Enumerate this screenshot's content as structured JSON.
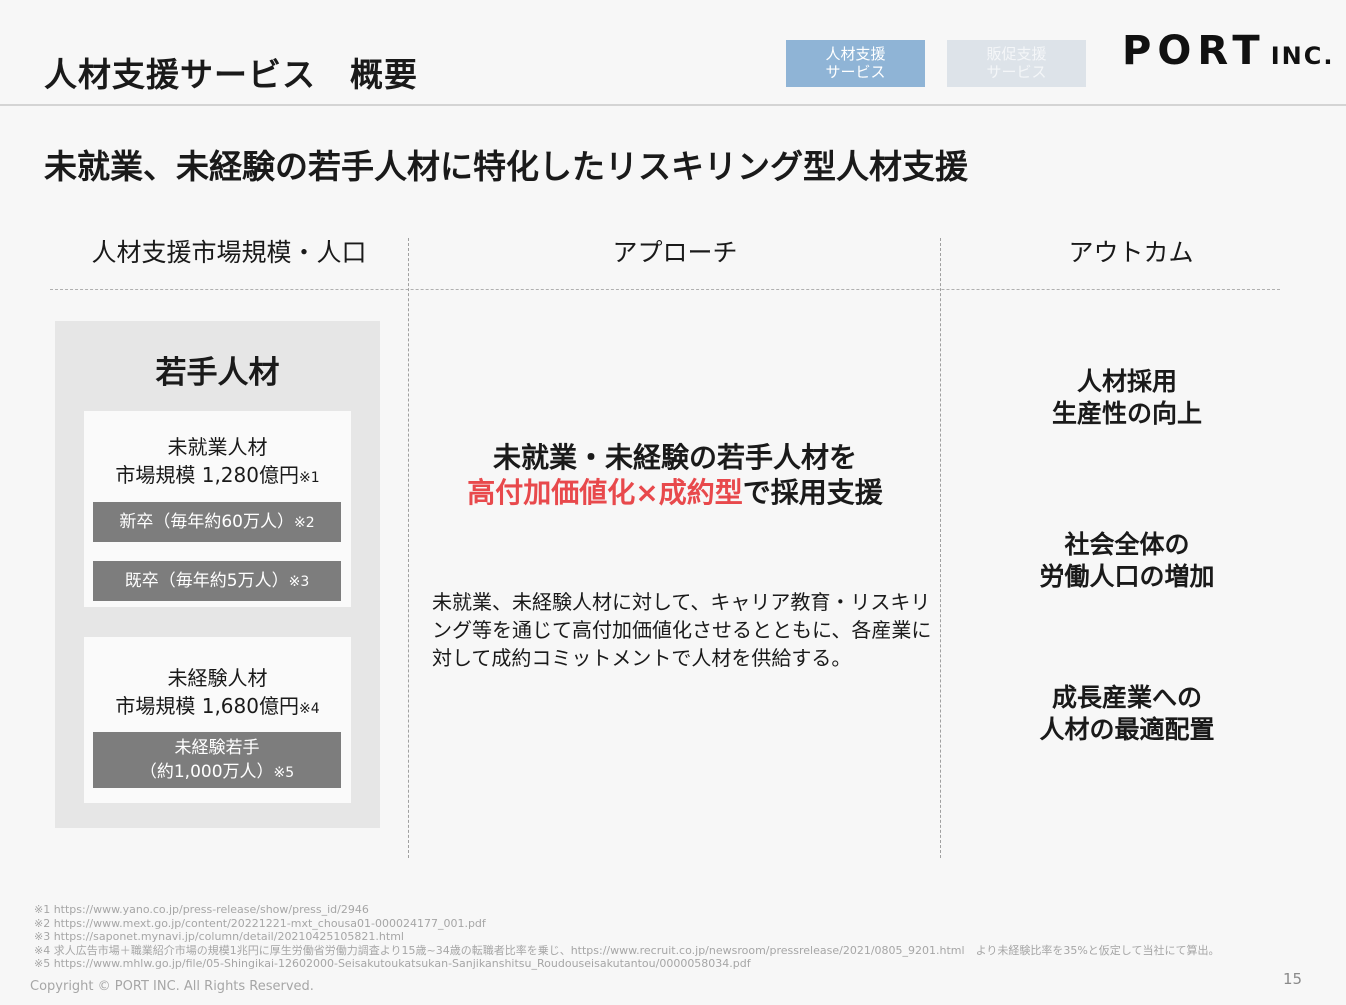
{
  "header": {
    "title": "人材支援サービス　概要",
    "tag_active_line1": "人材支援",
    "tag_active_line2": "サービス",
    "tag_inactive_line1": "販促支援",
    "tag_inactive_line2": "サービス",
    "logo_text": "PORT",
    "logo_suffix": "INC."
  },
  "main_heading": "未就業、未経験の若手人材に特化したリスキリング型人材支援",
  "columns": {
    "market": "人材支援市場規模・人口",
    "approach": "アプローチ",
    "outcome": "アウトカム"
  },
  "market": {
    "title": "若手人材",
    "card1": {
      "label": "未就業人材",
      "size": "市場規模 1,280億円",
      "note": "※1",
      "bar1": "新卒（毎年約60万人）",
      "bar1_note": "※2",
      "bar2": "既卒（毎年約5万人）",
      "bar2_note": "※3"
    },
    "card2": {
      "label": "未経験人材",
      "size": "市場規模 1,680億円",
      "note": "※4",
      "bar_line1": "未経験若手",
      "bar_line2": "（約1,000万人）",
      "bar_note": "※5"
    }
  },
  "approach": {
    "line1": "未就業・未経験の若手人材を",
    "line2_red": "高付加価値化×成約型",
    "line2_rest": "で採用支援",
    "body": "未就業、未経験人材に対して、キャリア教育・リスキリング等を通じて高付加価値化させるとともに、各産業に対して成約コミットメントで人材を供給する。"
  },
  "outcomes": [
    {
      "line1": "人材採用",
      "line2": "生産性の向上"
    },
    {
      "line1": "社会全体の",
      "line2": "労働人口の増加"
    },
    {
      "line1": "成長産業への",
      "line2": "人材の最適配置"
    }
  ],
  "footnotes": [
    "※1 https://www.yano.co.jp/press-release/show/press_id/2946",
    "※2 https://www.mext.go.jp/content/20221221-mxt_chousa01-000024177_001.pdf",
    "※3 https://saponet.mynavi.jp/column/detail/20210425105821.html",
    "※4 求人広告市場＋職業紹介市場の規模1兆円に厚生労働省労働力調査より15歳~34歳の転職者比率を乗じ、https://www.recruit.co.jp/newsroom/pressrelease/2021/0805_9201.html　より未経験比率を35%と仮定して当社にて算出。",
    "※5 https://www.mhlw.go.jp/file/05-Shingikai-12602000-Seisakutoukatsukan-Sanjikanshitsu_Roudouseisakutantou/0000058034.pdf"
  ],
  "copyright": "Copyright © PORT INC. All Rights Reserved.",
  "page_number": "15"
}
